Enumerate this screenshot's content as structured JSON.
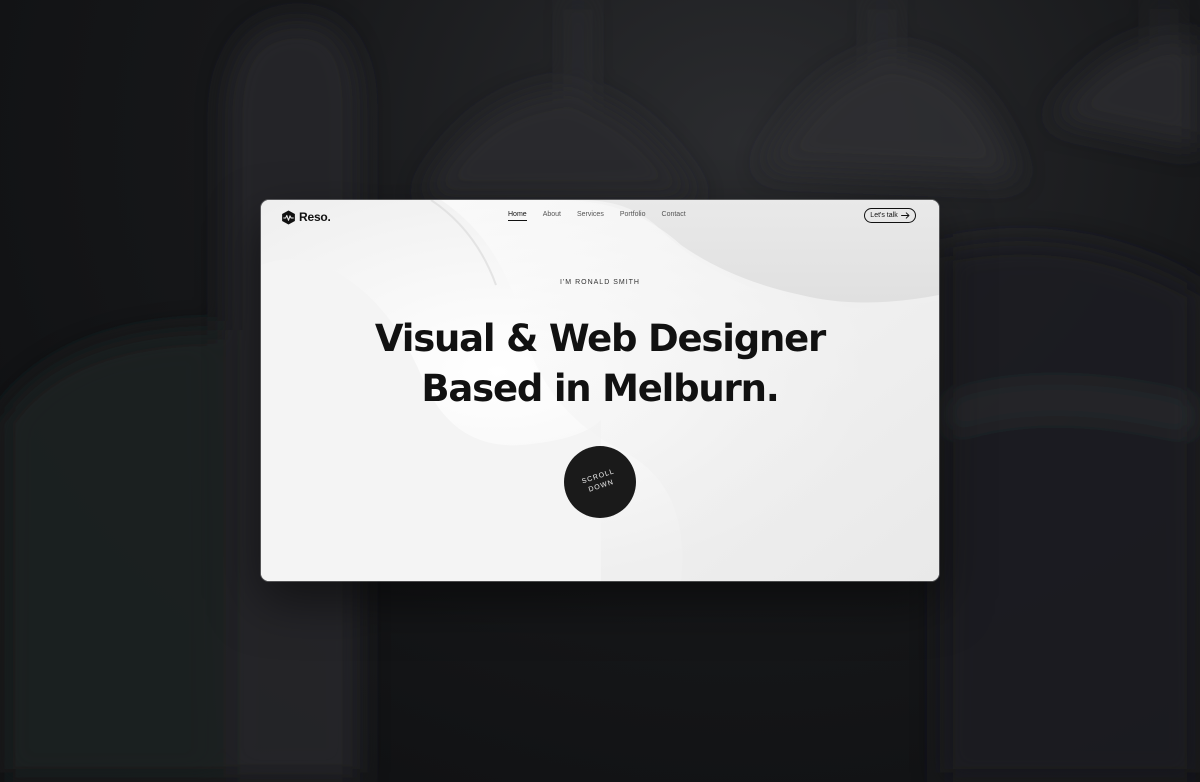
{
  "brand": {
    "name": "Reso.",
    "logo_icon": "hexagon-pulse-icon"
  },
  "nav": {
    "items": [
      {
        "label": "Home",
        "active": true
      },
      {
        "label": "About",
        "active": false
      },
      {
        "label": "Services",
        "active": false
      },
      {
        "label": "Portfolio",
        "active": false
      },
      {
        "label": "Contact",
        "active": false
      }
    ],
    "cta_label": "Let's talk",
    "cta_icon": "arrow-right-icon"
  },
  "hero": {
    "eyebrow": "I'M RONALD SMITH",
    "headline_line1": "Visual & Web Designer",
    "headline_line2": "Based in Melburn.",
    "scroll_line1": "SCROLL",
    "scroll_line2": "DOWN"
  },
  "colors": {
    "backdrop": "#111214",
    "window_bg": "#eeeeee",
    "text": "#111111",
    "button": "#1a1a1a"
  }
}
